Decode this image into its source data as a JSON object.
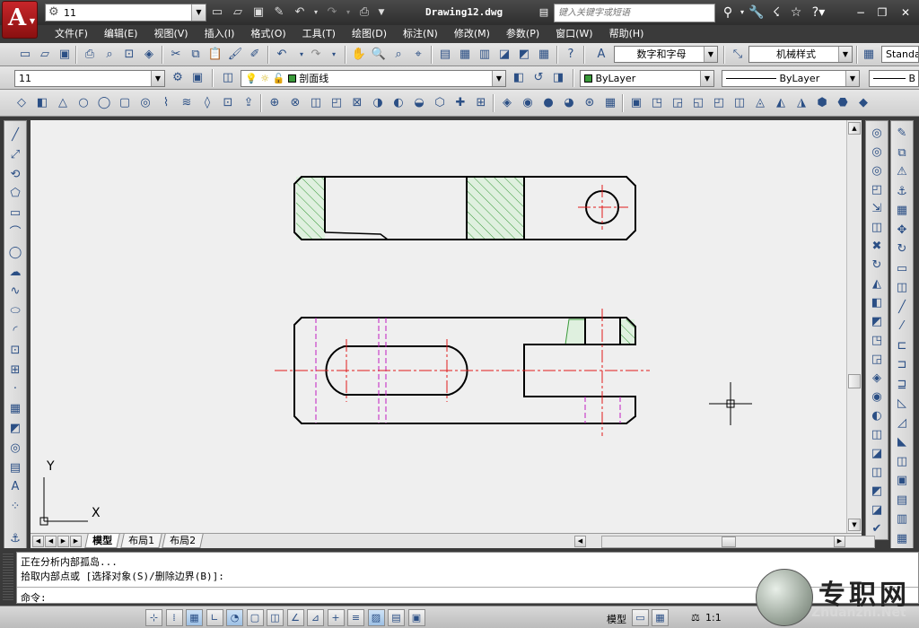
{
  "titlebar": {
    "workspace": "11",
    "document_title": "Drawing12.dwg",
    "search_placeholder": "键入关键字或短语",
    "minimize": "−",
    "restore": "❐",
    "close": "✕"
  },
  "menus": [
    "文件(F)",
    "编辑(E)",
    "视图(V)",
    "插入(I)",
    "格式(O)",
    "工具(T)",
    "绘图(D)",
    "标注(N)",
    "修改(M)",
    "参数(P)",
    "窗口(W)",
    "帮助(H)"
  ],
  "toolbar_styles": {
    "text_style": "数字和字母",
    "dim_style": "机械样式",
    "table_style": "Standa"
  },
  "toolbar_layers": {
    "workspace_combo": "11",
    "layer": "剖面线",
    "color": "ByLayer",
    "linetype": "ByLayer",
    "lineweight": "B"
  },
  "tabs": {
    "items": [
      {
        "label": "模型",
        "active": true
      },
      {
        "label": "布局1",
        "active": false
      },
      {
        "label": "布局2",
        "active": false
      }
    ]
  },
  "ucs": {
    "x": "X",
    "y": "Y"
  },
  "command": {
    "line1": "正在分析内部孤岛...",
    "line2": "拾取内部点或 [选择对象(S)/删除边界(B)]:",
    "prompt": "命令:"
  },
  "statusbar": {
    "model_label": "模型",
    "scale": "1:1"
  },
  "watermark": {
    "cn": "专职网",
    "en": "Zhuanzhi.Net"
  },
  "colors": {
    "outline": "#000000",
    "centerline": "#e11b1b",
    "hidden": "#c21ec2",
    "hatch": "#3a9a3a",
    "hatch_fill": "#dff0df"
  }
}
